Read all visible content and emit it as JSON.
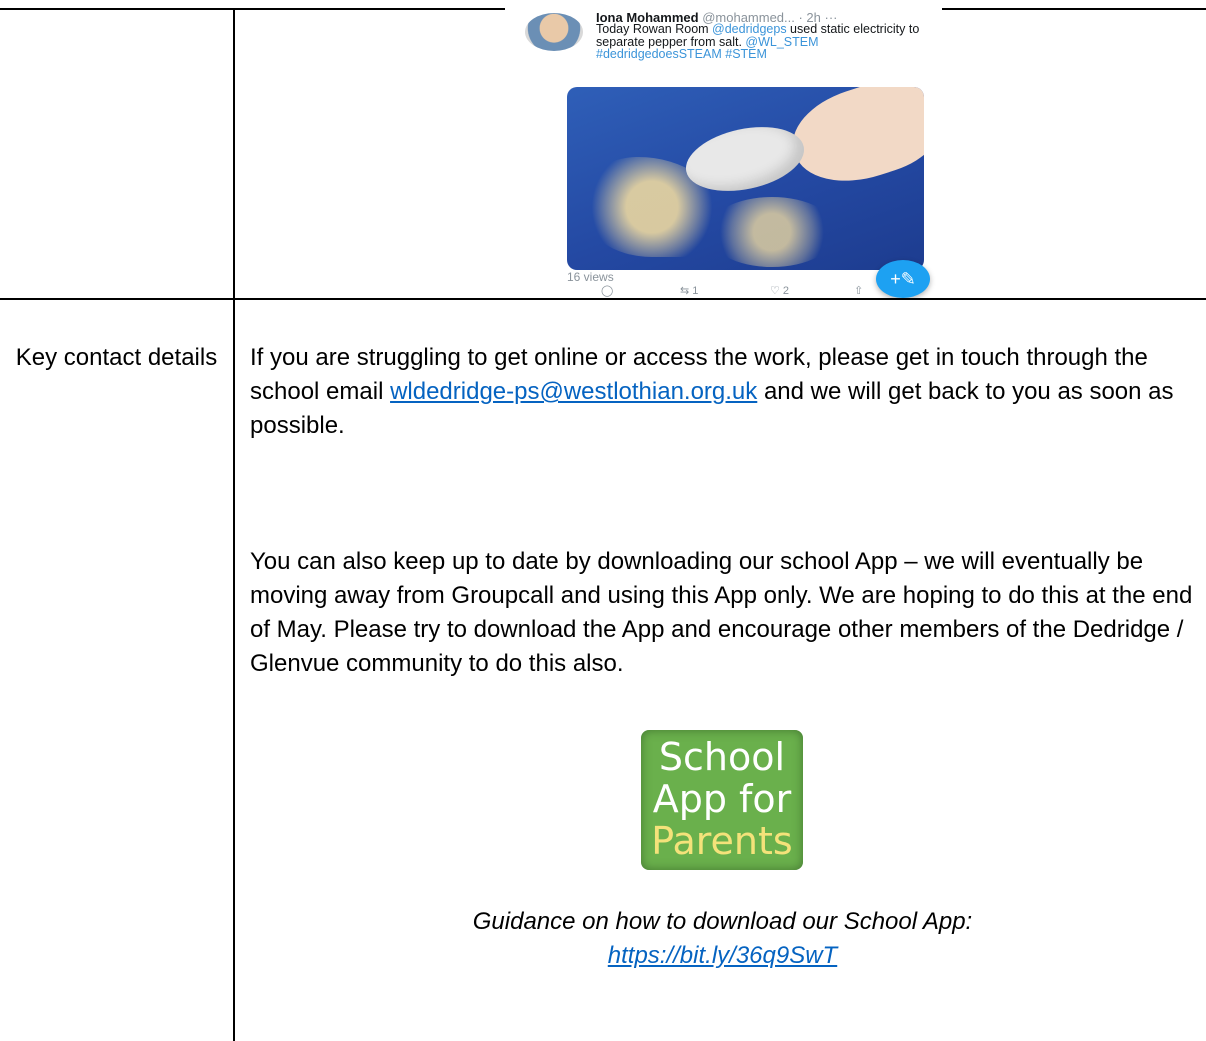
{
  "tweet": {
    "name": "Iona Mohammed",
    "handle_time": "@mohammed... · 2h ···",
    "text_plain_1": "Today Rowan Room ",
    "mention_1": "@dedridgeps",
    "text_plain_2": " used static electricity to separate pepper from salt. ",
    "tags": "@WL_STEM #dedridgedoesSTEAM #STEM",
    "views": "16 views",
    "reply_count": "",
    "retweet_count": "1",
    "like_count": "2",
    "fab_icon": "+✎"
  },
  "row": {
    "label": "Key contact details",
    "para1_before": "If you are struggling to get online or access the work, please get in touch through the school email ",
    "email": "wldedridge-ps@westlothian.org.uk",
    "para1_after": " and we will get back to you as soon as possible.",
    "para2": "You can also keep up to date by downloading our school App – we will eventually be moving away from Groupcall and using this App only. We are hoping to do this at the end of May. Please try to download the App and encourage other members of the Dedridge / Glenvue community to do this also.",
    "logo": {
      "line1": "School",
      "line2": "App for",
      "line3": "Parents"
    },
    "guidance_text": "Guidance on how to download our School App:",
    "guidance_url": "https://bit.ly/36q9SwT"
  },
  "icons": {
    "reply": "reply-icon",
    "retweet": "retweet-icon",
    "like": "heart-icon",
    "share": "share-icon"
  }
}
